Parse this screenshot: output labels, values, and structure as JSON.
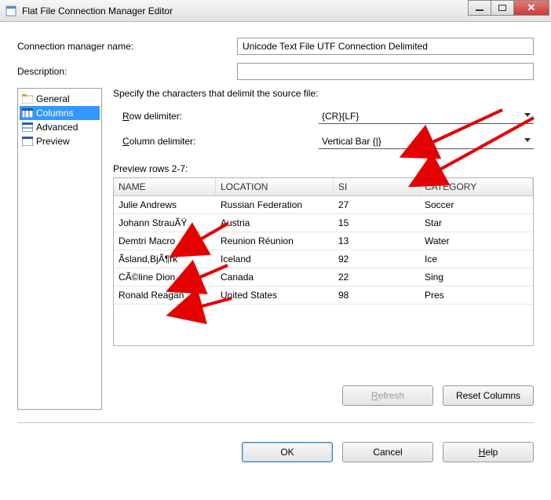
{
  "window": {
    "title": "Flat File Connection Manager Editor"
  },
  "form": {
    "conn_name_label": "Connection manager name:",
    "conn_name_value": "Unicode Text File UTF Connection Delimited",
    "desc_label": "Description:",
    "desc_value": ""
  },
  "tree": {
    "items": [
      {
        "label": "General"
      },
      {
        "label": "Columns"
      },
      {
        "label": "Advanced"
      },
      {
        "label": "Preview"
      }
    ],
    "selected_index": 1
  },
  "instruction": "Specify the characters that delimit the source file:",
  "delimiters": {
    "row_label": "Row delimiter:",
    "row_value": "{CR}{LF}",
    "col_label": "Column delimiter:",
    "col_value": "Vertical Bar {|}"
  },
  "preview": {
    "label": "Preview rows 2-7:",
    "headers": [
      "NAME",
      "LOCATION",
      "SI",
      "CATEGORY"
    ],
    "rows": [
      {
        "c0": "Julie Andrews",
        "c1": "Russian Federation",
        "c2": "27",
        "c3": "Soccer"
      },
      {
        "c0": "Johann StrauÃŸ",
        "c1": "Austria",
        "c2": "15",
        "c3": "Star"
      },
      {
        "c0": "Demtri Macro",
        "c1": "Reunion Réunion",
        "c2": "13",
        "c3": "Water"
      },
      {
        "c0": "Ãsland,BjÃ¶rk",
        "c1": "Iceland",
        "c2": "92",
        "c3": "Ice"
      },
      {
        "c0": "CÃ©line Dion",
        "c1": "Canada",
        "c2": "22",
        "c3": "Sing"
      },
      {
        "c0": "Ronald Reagan",
        "c1": "United States",
        "c2": "98",
        "c3": "Pres"
      }
    ]
  },
  "buttons": {
    "refresh": "Refresh",
    "reset": "Reset Columns",
    "ok": "OK",
    "cancel": "Cancel",
    "help": "Help"
  }
}
